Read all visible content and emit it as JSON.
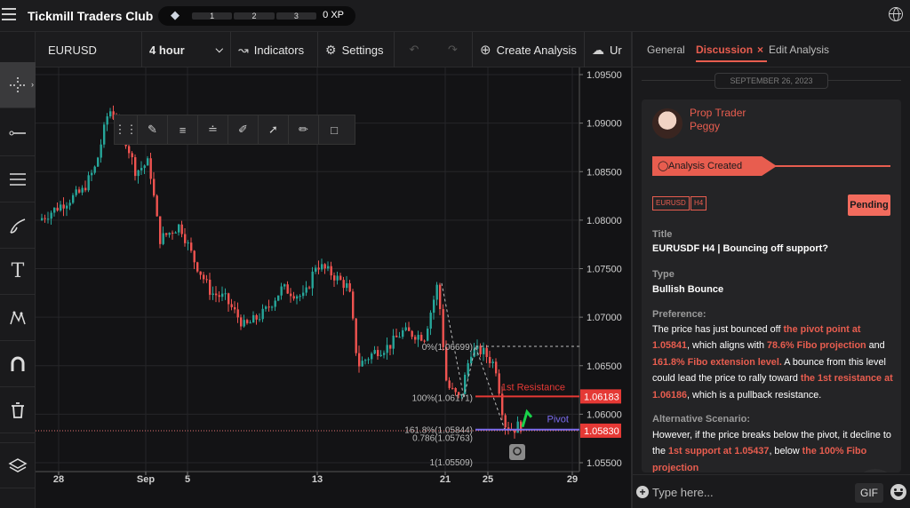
{
  "app": {
    "title": "Tickmill Traders Club",
    "xp_levels": [
      "1",
      "2",
      "3"
    ],
    "xp": "0 XP"
  },
  "toolbar": {
    "symbol": "EURUSD",
    "timeframe": "4 hour",
    "indicators": "Indicators",
    "settings": "Settings",
    "create_analysis": "Create Analysis",
    "upload": "Ur"
  },
  "chart": {
    "price_ticks": [
      "1.09500",
      "1.09000",
      "1.08500",
      "1.08000",
      "1.07500",
      "1.07000",
      "1.06500",
      "1.06000",
      "1.05500"
    ],
    "date_ticks": [
      "28",
      "Sep",
      "5",
      "13",
      "21",
      "25",
      "29"
    ],
    "fib_labels": [
      "0%(1.06699)",
      "100%(1.06171)",
      "161.8%(1.05844)",
      "0.786(1.05763)",
      "1(1.05509)"
    ],
    "resistance_label": "1st Resistance",
    "pivot_label": "Pivot",
    "price_tags": [
      {
        "text": "1.06183",
        "color": "#e53935"
      },
      {
        "text": "1.05830",
        "color": "#e53935"
      }
    ],
    "colors": {
      "up": "#26a69a",
      "down": "#ef5350",
      "pivot": "#7b6cf0",
      "resistance": "#e53935",
      "arrow": "#19d24a"
    }
  },
  "panel": {
    "tabs": [
      "General",
      "Discussion",
      "Edit Analysis"
    ],
    "date": "SEPTEMBER 26, 2023",
    "post": {
      "role": "Prop Trader",
      "user": "Peggy",
      "status_banner": "Analysis Created",
      "tags": [
        "EURUSD",
        "H4"
      ],
      "status": "Pending",
      "title_label": "Title",
      "title": "EURUSDF H4 | Bouncing off support?",
      "type_label": "Type",
      "type": "Bullish Bounce",
      "preference_label": "Preference:",
      "preference": [
        {
          "t": "The price has just bounced off ",
          "h": false
        },
        {
          "t": "the pivot point at 1.05841",
          "h": true
        },
        {
          "t": ", which aligns with ",
          "h": false
        },
        {
          "t": "78.6% Fibo projection",
          "h": true
        },
        {
          "t": " and ",
          "h": false
        },
        {
          "t": "161.8% Fibo extension level.",
          "h": true
        },
        {
          "t": " A bounce from this level could lead the price to rally toward ",
          "h": false
        },
        {
          "t": "the 1st resistance at 1.06186",
          "h": true
        },
        {
          "t": ", which is a pullback resistance.",
          "h": false
        }
      ],
      "alt_label": "Alternative Scenario:",
      "alt": [
        {
          "t": "However, if the price breaks below the pivot, it",
          "h": false
        },
        {
          "t": " decline to the ",
          "h": false
        },
        {
          "t": "1st support at 1.05437",
          "h": true
        },
        {
          "t": ", below ",
          "h": false
        },
        {
          "t": "the 100% Fibo projection",
          "h": true
        }
      ]
    },
    "composer_placeholder": "Type here...",
    "gif": "GIF"
  }
}
